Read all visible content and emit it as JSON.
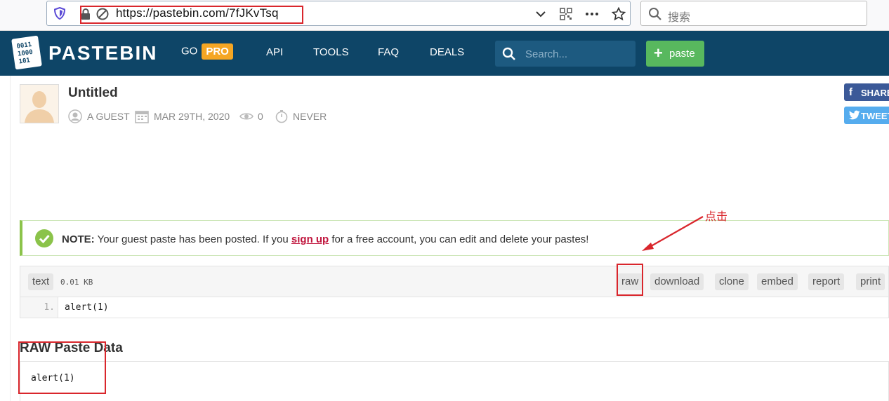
{
  "browser": {
    "url": "https://pastebin.com/7fJKvTsq",
    "search_placeholder": "搜索"
  },
  "header": {
    "logo_text": "PASTEBIN",
    "nav": {
      "go": "GO",
      "pro": "PRO",
      "api": "API",
      "tools": "TOOLS",
      "faq": "FAQ",
      "deals": "DEALS"
    },
    "search_placeholder": "Search...",
    "paste_button": "paste"
  },
  "paste": {
    "title": "Untitled",
    "author": "A GUEST",
    "date": "MAR 29TH, 2020",
    "views": "0",
    "expiry": "NEVER"
  },
  "share": {
    "facebook": "SHARE",
    "twitter": "TWEET"
  },
  "note": {
    "label": "NOTE:",
    "text_before": " Your guest paste has been posted. If you ",
    "link": "sign up",
    "text_after": " for a free account, you can edit and delete your pastes!"
  },
  "annotation": {
    "text": "点击"
  },
  "code": {
    "syntax": "text",
    "size": "0.01 KB",
    "actions": [
      "raw",
      "download",
      "clone",
      "embed",
      "report",
      "print"
    ],
    "line_number": "1.",
    "line": "alert(1)"
  },
  "raw_section": {
    "title": "RAW Paste Data",
    "content": "alert(1)"
  },
  "colors": {
    "header_bg": "#0e4567",
    "pro_badge": "#f5a623",
    "paste_button": "#58b85e",
    "note_accent": "#8bc34a",
    "annotation_red": "#d9262c",
    "facebook": "#3b5998",
    "twitter": "#55acee"
  }
}
